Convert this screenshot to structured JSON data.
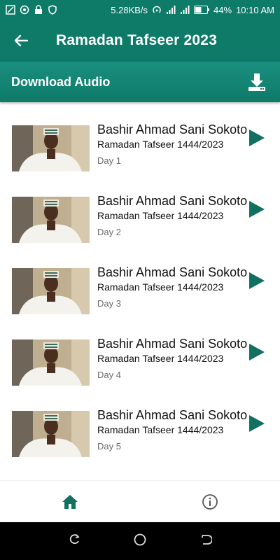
{
  "status_bar": {
    "net_speed": "5.28KB/s",
    "battery": "44%",
    "time": "10:10 AM"
  },
  "app_bar": {
    "back_icon": "arrow-left-icon",
    "title": "Ramadan Tafseer 2023"
  },
  "download": {
    "label": "Download Audio",
    "icon": "download-icon"
  },
  "items": [
    {
      "title": "Bashir Ahmad Sani Sokoto",
      "subtitle": "Ramadan Tafseer 1444/2023",
      "day": "Day 1"
    },
    {
      "title": "Bashir Ahmad Sani Sokoto",
      "subtitle": "Ramadan Tafseer 1444/2023",
      "day": "Day 2"
    },
    {
      "title": "Bashir Ahmad Sani Sokoto",
      "subtitle": "Ramadan Tafseer 1444/2023",
      "day": "Day 3"
    },
    {
      "title": "Bashir Ahmad Sani Sokoto",
      "subtitle": "Ramadan Tafseer 1444/2023",
      "day": "Day 4"
    },
    {
      "title": "Bashir Ahmad Sani Sokoto",
      "subtitle": "Ramadan Tafseer 1444/2023",
      "day": "Day 5"
    }
  ],
  "bottom_nav": {
    "home_icon": "home-icon",
    "info_icon": "info-icon"
  },
  "colors": {
    "primary": "#0e7a68",
    "accent": "#11705f"
  }
}
